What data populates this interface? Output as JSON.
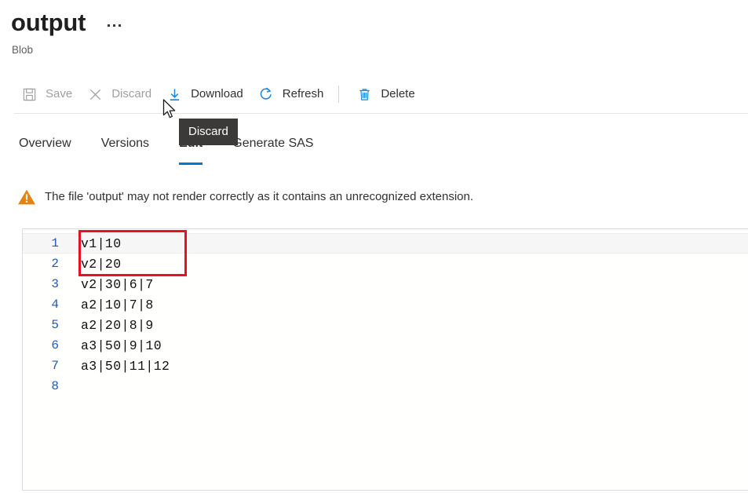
{
  "header": {
    "title": "output",
    "subtitle": "Blob",
    "more_menu": "…"
  },
  "toolbar": {
    "commands": [
      {
        "label": "Save",
        "icon": "save-icon",
        "enabled": false
      },
      {
        "label": "Discard",
        "icon": "discard-icon",
        "enabled": false
      },
      {
        "label": "Download",
        "icon": "download-icon",
        "enabled": true
      },
      {
        "label": "Refresh",
        "icon": "refresh-icon",
        "enabled": true
      },
      {
        "label": "Delete",
        "icon": "delete-icon",
        "enabled": true
      }
    ]
  },
  "tooltip": {
    "text": "Discard"
  },
  "tabs": {
    "items": [
      {
        "label": "Overview",
        "active": false
      },
      {
        "label": "Versions",
        "active": false
      },
      {
        "label": "Edit",
        "active": true
      },
      {
        "label": "Generate SAS",
        "active": false
      }
    ]
  },
  "warning": {
    "icon": "warning-triangle-icon",
    "message": "The file 'output' may not render correctly as it contains an unrecognized extension."
  },
  "editor": {
    "lines": [
      {
        "number": "1",
        "text": "v1|10",
        "current": true
      },
      {
        "number": "2",
        "text": "v2|20",
        "current": false
      },
      {
        "number": "3",
        "text": "v2|30|6|7",
        "current": false
      },
      {
        "number": "4",
        "text": "a2|10|7|8",
        "current": false
      },
      {
        "number": "5",
        "text": "a2|20|8|9",
        "current": false
      },
      {
        "number": "6",
        "text": "a3|50|9|10",
        "current": false
      },
      {
        "number": "7",
        "text": "a3|50|11|12",
        "current": false
      },
      {
        "number": "8",
        "text": "",
        "current": false
      }
    ]
  },
  "colors": {
    "accent": "#0078d4",
    "warning": "#e8820c",
    "annotation": "#e81123",
    "tooltip_bg": "#3b3a39",
    "line_number": "#1f5bb5",
    "disabled_text": "#a19f9d"
  }
}
